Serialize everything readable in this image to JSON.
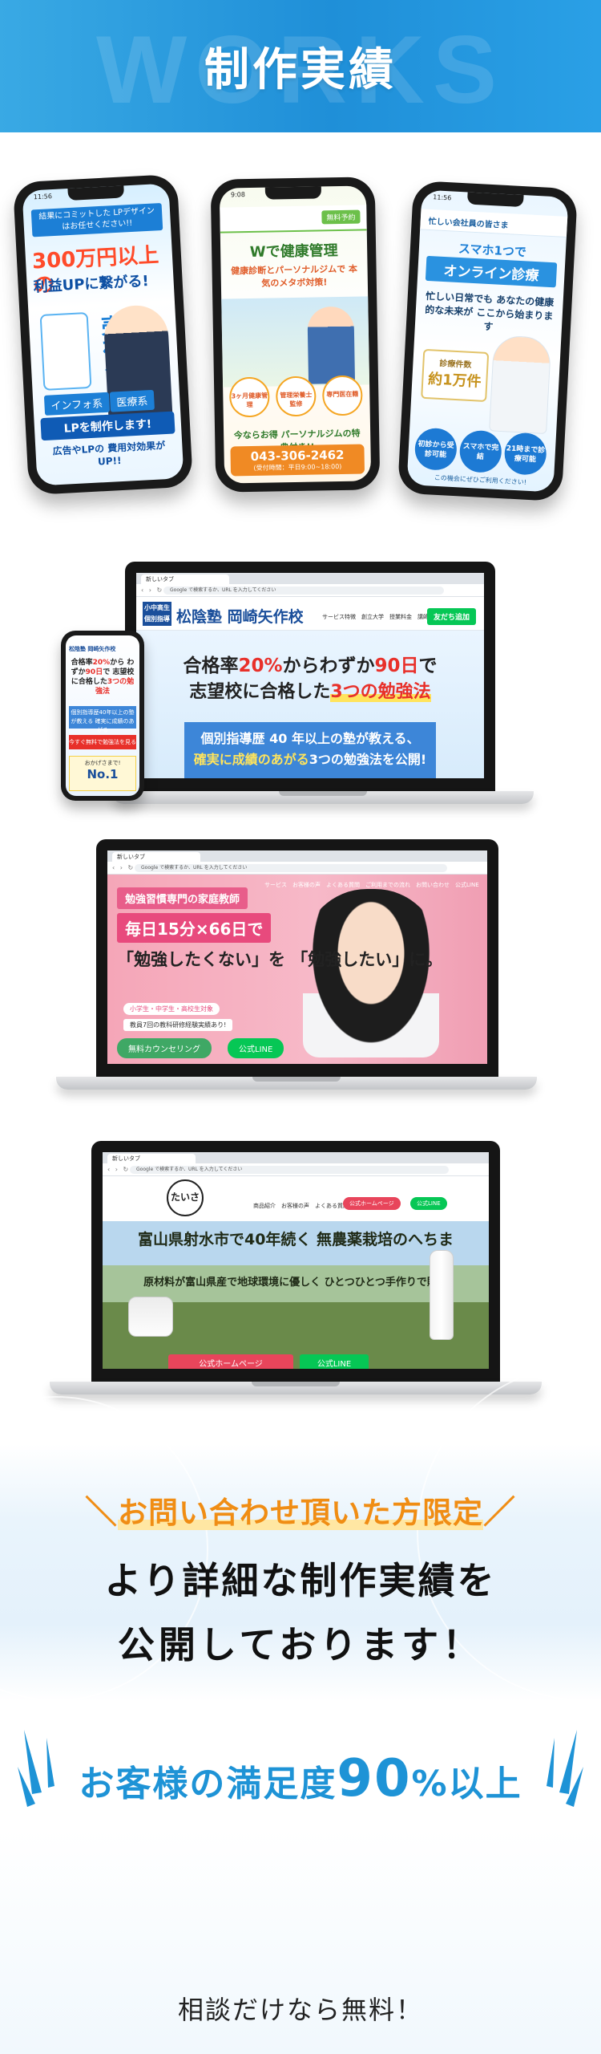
{
  "header": {
    "watermark": "WORKS",
    "title": "制作実績"
  },
  "phones": {
    "p1": {
      "time": "11:56",
      "intro": "結果にコミットした LPデザインはお任せください!!",
      "big": "300万円以上の",
      "big2": "利益UPに繋がる!",
      "sell": "売れる",
      "tag_a": "インフォ系",
      "tag_b": "医療系",
      "lp": "LPを制作します!",
      "foot": "広告やLPの 費用対効果がUP!!"
    },
    "p2": {
      "time": "9:08",
      "hd_btn": "無料予約",
      "h1": "Wで健康管理",
      "h2": "健康診断とパーソナルジムで 本気のメタボ対策!",
      "badge1": "3ヶ月健康管理",
      "badge2": "管理栄養士監修",
      "badge3": "専門医在籍",
      "line": "今ならお得 パーソナルジムの特典付き!!",
      "tel": "043-306-2462",
      "tel_note": "(受付時間：平日9:00~18:00)"
    },
    "p3": {
      "time": "11:56",
      "hd": "忙しい会社員の皆さま",
      "l1": "スマホ1つで",
      "l2": "オンライン診療",
      "l3": "忙しい日常でも あなたの健康的な未来が ここから始まります",
      "cnt_label": "診療件数",
      "cnt_value": "約1万件",
      "c1": "初診から受診可能",
      "c2": "スマホで完結",
      "c3": "21時まで診療可能",
      "foot": "この機会にぜひご利用ください!"
    }
  },
  "laptops": {
    "browser": {
      "tab": "新しいタブ",
      "url": "Google で検索するか、URL を入力してください"
    },
    "school": {
      "logo": "小中高生 個別指導",
      "name": "松陰塾 岡崎矢作校",
      "nav": "サービス特徴　創立大学　授業料金　講師プロフィール",
      "line_btn": "友だち追加",
      "c1_a": "合格率",
      "c1_b": "20%",
      "c1_c": "からわずか",
      "c1_d": "90日",
      "c1_e": "で",
      "c2_a": "志望校に合格した",
      "c2_b": "3つの勉強法",
      "band1": "個別指導歴 40 年以上の塾が教える、",
      "band2_a": "確実に成績のあがる",
      "band2_b": "3つの勉強法を公開!"
    },
    "mphone": {
      "m1": "松陰塾 岡崎矢作校",
      "m2_a": "合格率",
      "m2_b": "20%",
      "m2_c": "から わずか",
      "m2_d": "90日",
      "m2_e": "で 志望校に合格した",
      "m2_f": "3つの勉強法",
      "m3": "個別指導歴40年以上の塾が教える 確実に成績のあがる",
      "m4": "今すぐ無料で勉強法を見る",
      "m5": "おかげさまで!",
      "m5_b": "No.1"
    },
    "tutor": {
      "nav": "サービス　お客様の声　よくある質問　ご利用までの流れ　お問い合わせ　公式LINE",
      "t1": "勉強習慣専門の家庭教師",
      "t2": "毎日15分×66日で",
      "t3": "「勉強したくない」を 「勉強したい」に。",
      "t4": "小学生・中学生・高校生対象",
      "t5": "教員7回の教科研修経験実績あり!",
      "b1": "無料カウンセリング",
      "b2": "公式LINE"
    },
    "garlic": {
      "seal": "たいさん",
      "nav": "商品紹介　お客様の声　よくある質問",
      "ob": "公式ホームページ",
      "lb": "公式LINE",
      "c1": "富山県射水市で40年続く 無農薬栽培のへちま",
      "c2": "原材料が富山県産で地球環境に優しく ひとつひとつ手作りで販売",
      "ob2": "公式ホームページ",
      "lb2": "公式LINE"
    }
  },
  "info": {
    "limited": "お問い合わせ頂いた方限定",
    "line1": "より詳細な制作実績を",
    "line2": "公開しております！"
  },
  "satisfaction": {
    "pre": "お客様の満足度",
    "num": "90",
    "post": "%以上"
  },
  "bottom": {
    "free": "相談だけなら無料！"
  },
  "colors": {
    "brand_blue": "#2aa0e6",
    "accent_orange": "#f08d14",
    "line_green": "#06c755"
  }
}
